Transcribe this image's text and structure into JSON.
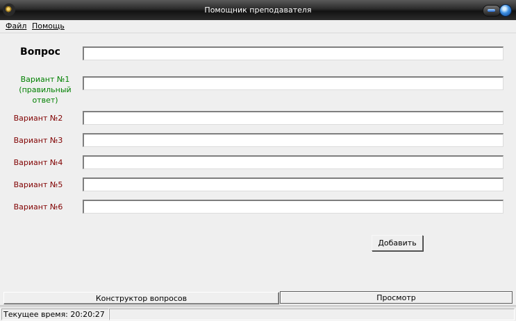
{
  "window": {
    "title": "Помощник преподавателя"
  },
  "menu": {
    "file": "Файл",
    "help": "Помощь"
  },
  "form": {
    "question_label": "Вопрос",
    "question_value": "",
    "variant1_label_line1": "Вариант №1",
    "variant1_label_line2": "(правильный ответ)",
    "variant1_value": "",
    "variant2_label": "Вариант №2",
    "variant2_value": "",
    "variant3_label": "Вариант №3",
    "variant3_value": "",
    "variant4_label": "Вариант №4",
    "variant4_value": "",
    "variant5_label": "Вариант №5",
    "variant5_value": "",
    "variant6_label": "Вариант №6",
    "variant6_value": "",
    "add_button": "Добавить"
  },
  "tabs": {
    "constructor": "Конструктор вопросов",
    "preview": "Просмотр",
    "active": "constructor"
  },
  "status": {
    "current_time_label": "Текущее время:",
    "current_time": "20:20:27"
  },
  "colors": {
    "correct_variant": "#008000",
    "variant": "#800000",
    "titlebar": "#1a1a1a"
  },
  "icons": {
    "app": "gear-icon",
    "minimize": "minimize-icon",
    "close": "close-icon"
  }
}
